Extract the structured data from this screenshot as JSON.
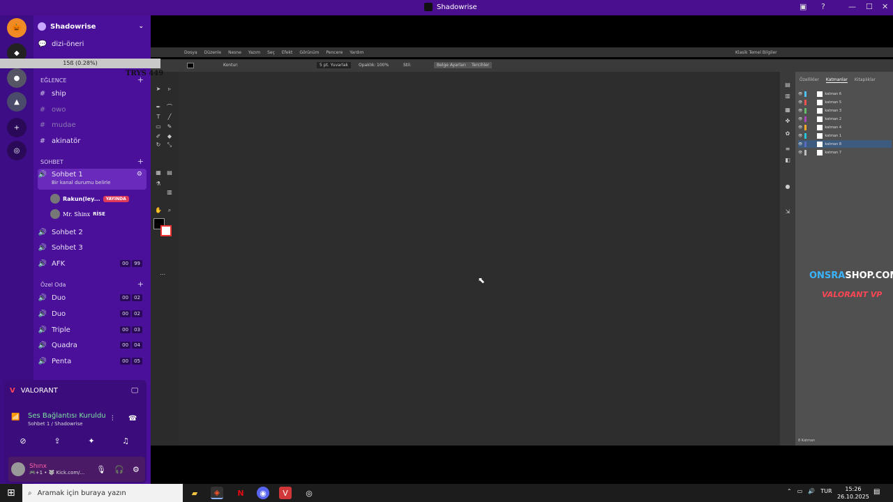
{
  "window": {
    "title": "Shadowrise"
  },
  "server": {
    "name": "Shadowrise"
  },
  "channels_top": [
    {
      "name": "dizi-öneri",
      "icon": "speech-icon"
    }
  ],
  "categories": {
    "eglence": "EĞLENCE",
    "sohbet": "SOHBET",
    "ozel_oda": "Özel Oda"
  },
  "text_channels": [
    {
      "name": "ship",
      "dim": false
    },
    {
      "name": "owo",
      "dim": true
    },
    {
      "name": "mudae",
      "dim": true
    },
    {
      "name": "akinatör",
      "dim": false
    }
  ],
  "voice_channels": {
    "active": {
      "name": "Sohbet 1",
      "status": "Bir kanal durumu belirle"
    },
    "members": [
      {
        "name": "Rakun(ley...",
        "badge": "YAYINDA"
      },
      {
        "name": "Mr. Shinx",
        "badge": "RİSE"
      }
    ],
    "others": [
      {
        "name": "Sohbet 2"
      },
      {
        "name": "Sohbet 3"
      },
      {
        "name": "AFK",
        "c1": "00",
        "c2": "99"
      }
    ],
    "private": [
      {
        "name": "Duo",
        "c1": "00",
        "c2": "02"
      },
      {
        "name": "Duo",
        "c1": "00",
        "c2": "02"
      },
      {
        "name": "Triple",
        "c1": "00",
        "c2": "03"
      },
      {
        "name": "Quadra",
        "c1": "00",
        "c2": "04"
      },
      {
        "name": "Penta",
        "c1": "00",
        "c2": "05"
      }
    ]
  },
  "voice_panel": {
    "game": "VALORANT",
    "connection": "Ses Bağlantısı Kuruldu",
    "connection_sub": "Sohbet 1 / Shadowrise",
    "user_name": "Shınx",
    "user_status": "🎮+1 • 🐺 Kick.com/..."
  },
  "overlay": {
    "volume_text": "15ß (0.28%)",
    "label": "TRYS 449"
  },
  "illustrator": {
    "menu": [
      "Dosya",
      "Düzenle",
      "Nesne",
      "Yazım",
      "Seç",
      "Efekt",
      "Görünüm",
      "Pencere",
      "Yardım"
    ],
    "workspace": "Klasik Temel Bilgiler",
    "ctrl": {
      "stroke_label": "Kontur:",
      "brush": "5 pt. Yuvarlak",
      "opacity_label": "Opaklık:",
      "opacity": "100%",
      "style_label": "Stil:",
      "doc_setup": "Belge Ayarları",
      "prefs": "Tercihler"
    },
    "panel_tabs": [
      "Özellikler",
      "Katmanlar",
      "Kitaplıklar"
    ],
    "layers": [
      {
        "name": "katman 6",
        "color": "#4fc3f7"
      },
      {
        "name": "katman 5",
        "color": "#ef5350"
      },
      {
        "name": "katman 3",
        "color": "#66bb6a"
      },
      {
        "name": "katman 2",
        "color": "#ab47bc"
      },
      {
        "name": "katman 4",
        "color": "#ffa726"
      },
      {
        "name": "katman 1",
        "color": "#26c6da"
      },
      {
        "name": "katman 8",
        "color": "#5c6bc0",
        "selected": true
      },
      {
        "name": "katman 7",
        "color": "#bdbdbd"
      }
    ],
    "layer_count": "8 Katman"
  },
  "stream_overlay": {
    "shop_a": "ONSRA",
    "shop_b": "SHOP.COM",
    "val_ad": "VALORANT VP"
  },
  "taskbar": {
    "search_placeholder": "Aramak için buraya yazın",
    "lang": "TUR",
    "time": "15:26",
    "date": "26.10.2025"
  }
}
